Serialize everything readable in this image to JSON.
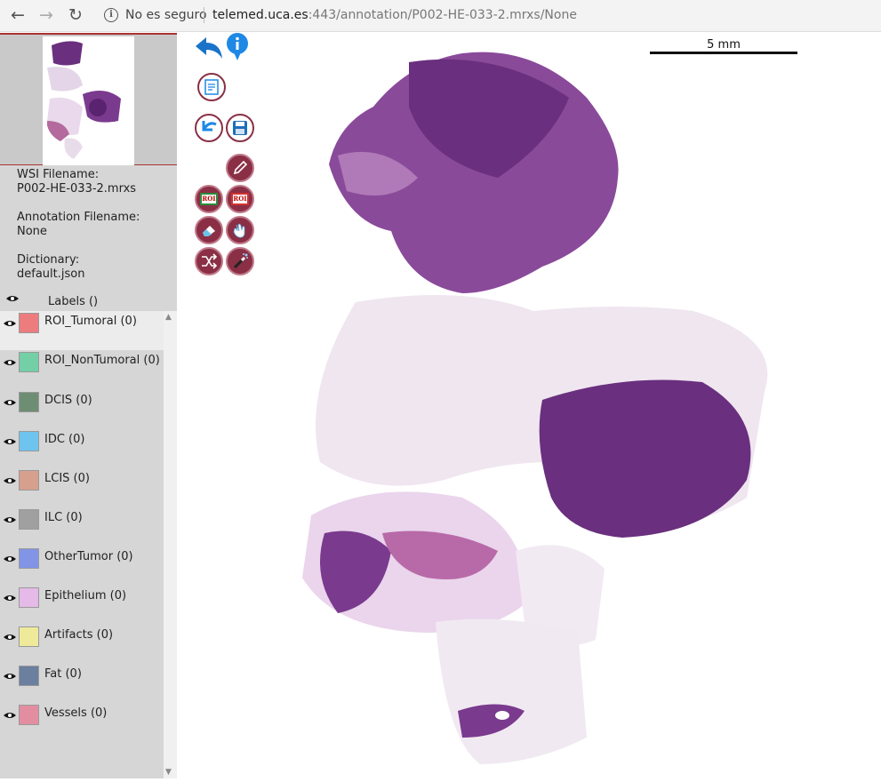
{
  "browser": {
    "security_text": "No es seguro",
    "url_host": "telemed.uca.es",
    "url_rest": ":443/annotation/P002-HE-033-2.mrxs/None"
  },
  "sidebar": {
    "wsi_label": "WSI Filename:",
    "wsi_value": "P002-HE-033-2.mrxs",
    "annotation_label": "Annotation Filename:",
    "annotation_value": "None",
    "dictionary_label": "Dictionary:",
    "dictionary_value": "default.json",
    "labels_title": "Labels ()",
    "labels": [
      {
        "text": "ROI_Tumoral (0)",
        "color": "#ec7c7e"
      },
      {
        "text": "ROI_NonTumoral (0)",
        "color": "#73cfa6"
      },
      {
        "text": "DCIS (0)",
        "color": "#6e8e73"
      },
      {
        "text": "IDC (0)",
        "color": "#6ec4ee"
      },
      {
        "text": "LCIS (0)",
        "color": "#d7a08e"
      },
      {
        "text": "ILC (0)",
        "color": "#a0a0a0"
      },
      {
        "text": "OtherTumor (0)",
        "color": "#8294e6"
      },
      {
        "text": "Epithelium (0)",
        "color": "#e5b9e8"
      },
      {
        "text": "Artifacts (0)",
        "color": "#eeea9a"
      },
      {
        "text": "Fat (0)",
        "color": "#6b7f9e"
      },
      {
        "text": "Vessels (0)",
        "color": "#e38ea0"
      }
    ]
  },
  "toolbar": {
    "roi_tag": "ROI",
    "icons": [
      "undo-arrow-icon",
      "info-icon",
      "notes-icon",
      "undo-icon",
      "save-icon",
      "pencil-icon",
      "roi-tumoral-icon",
      "roi-nontumoral-icon",
      "eraser-icon",
      "hand-icon",
      "shuffle-icon",
      "magic-wand-icon"
    ]
  },
  "scale": {
    "label": "5 mm"
  },
  "colors": {
    "accent": "#8a2f45",
    "tissue_dark": "#6a2f7e",
    "tissue_light": "#d8c4de"
  }
}
